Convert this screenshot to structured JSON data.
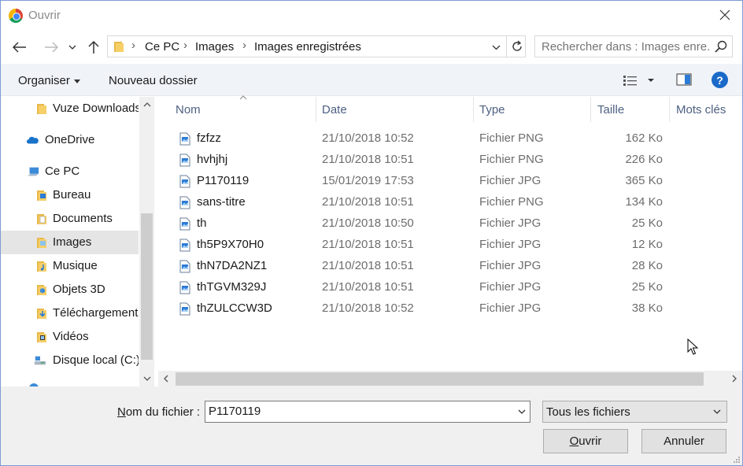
{
  "window": {
    "title": "Ouvrir"
  },
  "breadcrumb": [
    "Ce PC",
    "Images",
    "Images enregistrées"
  ],
  "search": {
    "placeholder": "Rechercher dans : Images enre..."
  },
  "toolbar": {
    "organise_label": "Organiser",
    "new_folder_label": "Nouveau dossier",
    "help_label": "?"
  },
  "sidebar": {
    "items": [
      {
        "label": "Vuze Downloads",
        "icon": "folder-icon"
      },
      {
        "label": "OneDrive",
        "icon": "cloud-icon"
      },
      {
        "label": "Ce PC",
        "icon": "computer-icon"
      },
      {
        "label": "Bureau",
        "icon": "desktop-folder-icon"
      },
      {
        "label": "Documents",
        "icon": "documents-folder-icon"
      },
      {
        "label": "Images",
        "icon": "pictures-folder-icon",
        "selected": true
      },
      {
        "label": "Musique",
        "icon": "music-folder-icon"
      },
      {
        "label": "Objets 3D",
        "icon": "3d-objects-folder-icon"
      },
      {
        "label": "Téléchargements",
        "icon": "downloads-folder-icon"
      },
      {
        "label": "Vidéos",
        "icon": "videos-folder-icon"
      },
      {
        "label": "Disque local (C:)",
        "icon": "drive-icon"
      }
    ]
  },
  "columns": {
    "name": "Nom",
    "date": "Date",
    "type": "Type",
    "size": "Taille",
    "tags": "Mots clés"
  },
  "files": [
    {
      "name": "fzfzz",
      "date": "21/10/2018 10:52",
      "type": "Fichier PNG",
      "size": "162 Ko"
    },
    {
      "name": "hvhjhj",
      "date": "21/10/2018 10:51",
      "type": "Fichier PNG",
      "size": "226 Ko"
    },
    {
      "name": "P1170119",
      "date": "15/01/2019 17:53",
      "type": "Fichier JPG",
      "size": "365 Ko"
    },
    {
      "name": "sans-titre",
      "date": "21/10/2018 10:51",
      "type": "Fichier PNG",
      "size": "134 Ko"
    },
    {
      "name": "th",
      "date": "21/10/2018 10:50",
      "type": "Fichier JPG",
      "size": "25 Ko"
    },
    {
      "name": "th5P9X70H0",
      "date": "21/10/2018 10:51",
      "type": "Fichier JPG",
      "size": "12 Ko"
    },
    {
      "name": "thN7DA2NZ1",
      "date": "21/10/2018 10:51",
      "type": "Fichier JPG",
      "size": "28 Ko"
    },
    {
      "name": "thTGVM329J",
      "date": "21/10/2018 10:51",
      "type": "Fichier JPG",
      "size": "25 Ko"
    },
    {
      "name": "thZULCCW3D",
      "date": "21/10/2018 10:52",
      "type": "Fichier JPG",
      "size": "38 Ko"
    }
  ],
  "footer": {
    "filename_label_prefix": "N",
    "filename_label_rest": "om du fichier :",
    "filename_value": "P1170119",
    "filetype_value": "Tous les fichiers",
    "open_label_prefix": "O",
    "open_label_rest": "uvrir",
    "cancel_label": "Annuler"
  }
}
